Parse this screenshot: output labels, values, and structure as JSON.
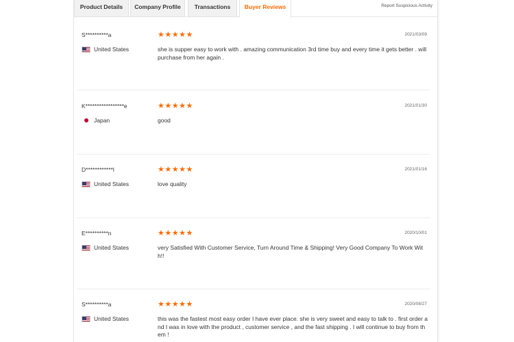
{
  "tabs": [
    {
      "label": "Product Details"
    },
    {
      "label": "Company Profile"
    },
    {
      "label": "Transactions"
    },
    {
      "label": "Buyer Reviews"
    }
  ],
  "report_link": "Report Suspicious Activity",
  "accent_color": "#ff6a00",
  "reviews": [
    {
      "reviewer": "S**********a",
      "country": "United States",
      "flag_icon": "us-flag-icon",
      "rating": 5,
      "stars": "★★★★★",
      "date": "2021/03/09",
      "comment": "she is supper easy to work with . amazing communication 3rd time buy and every time it gets better . will purchase from her again ."
    },
    {
      "reviewer": "K*****************e",
      "country": "Japan",
      "flag_icon": "jp-flag-icon",
      "rating": 5,
      "stars": "★★★★★",
      "date": "2021/01/30",
      "comment": "good"
    },
    {
      "reviewer": "D************l",
      "country": "United States",
      "flag_icon": "us-flag-icon",
      "rating": 5,
      "stars": "★★★★★",
      "date": "2021/01/16",
      "comment": "love quality"
    },
    {
      "reviewer": "E**********n",
      "country": "United States",
      "flag_icon": "us-flag-icon",
      "rating": 5,
      "stars": "★★★★★",
      "date": "2020/10/01",
      "comment": "very Satisfied With Customer Service, Turn Around Time & Shipping! Very Good Company To Work With!!"
    },
    {
      "reviewer": "S**********a",
      "country": "United States",
      "flag_icon": "us-flag-icon",
      "rating": 5,
      "stars": "★★★★★",
      "date": "2020/08/27",
      "comment": "this was the fastest most easy order I have ever place. she is very sweet and easy to talk to . first order and I was in love with the product , customer service , and the fast shipping . I will continue to buy from them !"
    }
  ]
}
